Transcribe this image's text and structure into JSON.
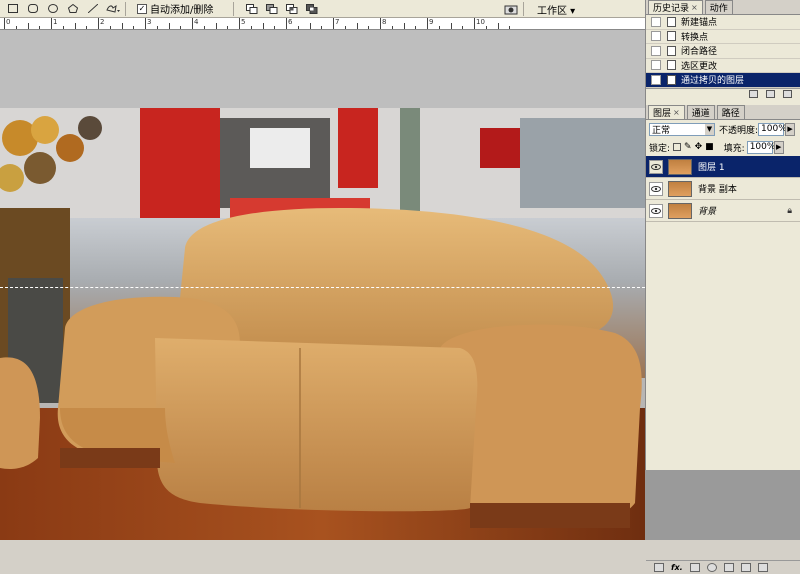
{
  "toolbar": {
    "auto_add_delete_label": "自动添加/删除",
    "auto_add_delete_checked": "✓",
    "workspace_label": "工作区 ▾"
  },
  "ruler": {
    "numbers": [
      "0",
      "1",
      "2",
      "3",
      "4",
      "5",
      "6",
      "7",
      "8",
      "9",
      "10"
    ]
  },
  "history_panel": {
    "tab_history": "历史记录",
    "tab_actions": "动作",
    "items": [
      {
        "label": "新建锚点"
      },
      {
        "label": "转换点"
      },
      {
        "label": "闭合路径"
      },
      {
        "label": "选区更改"
      },
      {
        "label": "通过拷贝的图层"
      }
    ]
  },
  "layers_panel": {
    "tab_layers": "图层",
    "tab_channels": "通道",
    "tab_paths": "路径",
    "blend_mode": "正常",
    "opacity_label": "不透明度:",
    "opacity_value": "100%",
    "lock_label": "锁定:",
    "fill_label": "填充:",
    "fill_value": "100%",
    "layers": [
      {
        "name": "图层 1",
        "selected": true
      },
      {
        "name": "背景 副本",
        "selected": false
      },
      {
        "name": "背景",
        "selected": false,
        "locked": true
      }
    ]
  },
  "colors": {
    "selection_highlight": "#0a246a",
    "sofa": "#d9a35f",
    "canvas_gray": "#bebebe"
  }
}
